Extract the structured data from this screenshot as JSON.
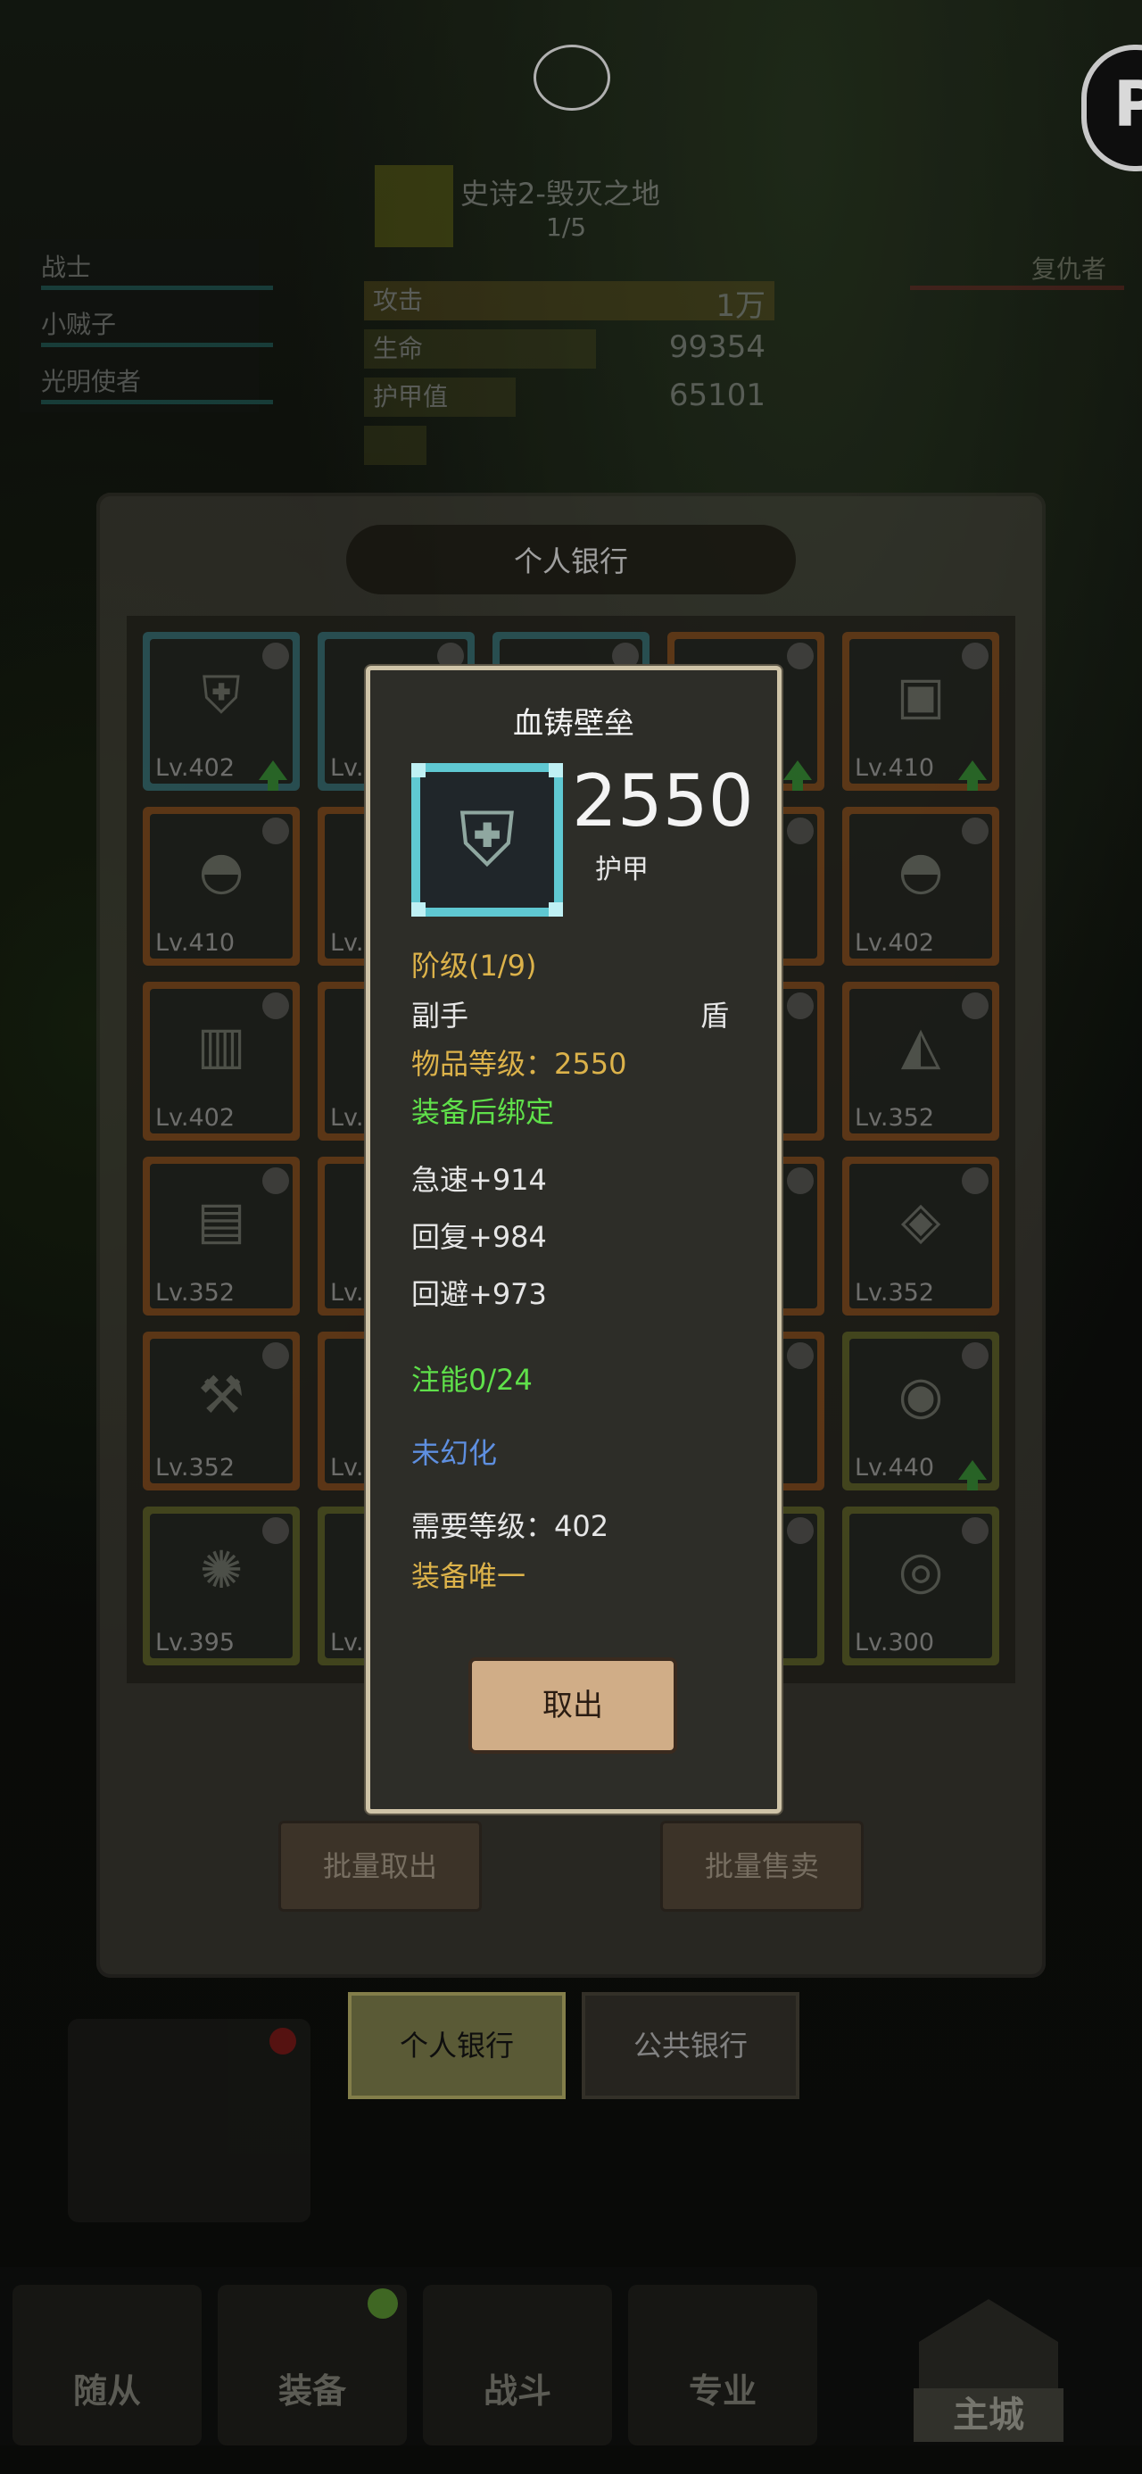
{
  "hud": {
    "stage_title": "史诗2-毁灭之地",
    "stage_progress": "1/5",
    "party": [
      "战士",
      "小贼子",
      "光明使者"
    ],
    "enemy": "复仇者",
    "stats": [
      {
        "label": "攻击",
        "value": "1万"
      },
      {
        "label": "生命",
        "value": "99354"
      },
      {
        "label": "护甲值",
        "value": "65101"
      }
    ]
  },
  "bank": {
    "title": "个人银行",
    "slots": [
      {
        "level": "Lv.402",
        "rarity": "teal",
        "upgrade": true,
        "icon": "shield-icon"
      },
      {
        "level": "Lv.",
        "rarity": "teal",
        "upgrade": false,
        "icon": "armor-icon"
      },
      {
        "level": "",
        "rarity": "teal",
        "upgrade": false,
        "icon": ""
      },
      {
        "level": "",
        "rarity": "orange",
        "upgrade": true,
        "icon": ""
      },
      {
        "level": "Lv.410",
        "rarity": "orange",
        "upgrade": true,
        "icon": "chest-icon"
      },
      {
        "level": "Lv.410",
        "rarity": "orange",
        "upgrade": false,
        "icon": "pauldron-icon"
      },
      {
        "level": "Lv.",
        "rarity": "orange",
        "upgrade": false,
        "icon": ""
      },
      {
        "level": "",
        "rarity": "orange",
        "upgrade": false,
        "icon": ""
      },
      {
        "level": "",
        "rarity": "orange",
        "upgrade": false,
        "icon": ""
      },
      {
        "level": "Lv.402",
        "rarity": "orange",
        "upgrade": false,
        "icon": "pauldron-icon"
      },
      {
        "level": "Lv.402",
        "rarity": "orange",
        "upgrade": false,
        "icon": "bracer-icon"
      },
      {
        "level": "Lv.",
        "rarity": "orange",
        "upgrade": false,
        "icon": ""
      },
      {
        "level": "",
        "rarity": "orange",
        "upgrade": false,
        "icon": ""
      },
      {
        "level": "",
        "rarity": "orange",
        "upgrade": false,
        "icon": ""
      },
      {
        "level": "Lv.352",
        "rarity": "orange",
        "upgrade": false,
        "icon": "boot-icon"
      },
      {
        "level": "Lv.352",
        "rarity": "orange",
        "upgrade": false,
        "icon": "chest-armor-icon"
      },
      {
        "level": "Lv.",
        "rarity": "orange",
        "upgrade": false,
        "icon": ""
      },
      {
        "level": "",
        "rarity": "orange",
        "upgrade": false,
        "icon": ""
      },
      {
        "level": "",
        "rarity": "orange",
        "upgrade": false,
        "icon": ""
      },
      {
        "level": "Lv.352",
        "rarity": "orange",
        "upgrade": false,
        "icon": "helmet-icon"
      },
      {
        "level": "Lv.352",
        "rarity": "orange",
        "upgrade": false,
        "icon": "mace-icon"
      },
      {
        "level": "Lv.",
        "rarity": "orange",
        "upgrade": false,
        "icon": ""
      },
      {
        "level": "",
        "rarity": "orange",
        "upgrade": false,
        "icon": ""
      },
      {
        "level": "",
        "rarity": "orange",
        "upgrade": false,
        "icon": ""
      },
      {
        "level": "Lv.440",
        "rarity": "green",
        "upgrade": true,
        "icon": "ring-icon"
      },
      {
        "level": "Lv.395",
        "rarity": "green",
        "upgrade": false,
        "icon": "amulet-icon"
      },
      {
        "level": "Lv.",
        "rarity": "green",
        "upgrade": false,
        "icon": ""
      },
      {
        "level": "",
        "rarity": "green",
        "upgrade": false,
        "icon": ""
      },
      {
        "level": "",
        "rarity": "green",
        "upgrade": false,
        "icon": ""
      },
      {
        "level": "Lv.300",
        "rarity": "green",
        "upgrade": false,
        "icon": "orb-icon"
      }
    ],
    "bulk_takeout": "批量取出",
    "bulk_sell": "批量售卖",
    "tab_personal": "个人银行",
    "tab_public": "公共银行"
  },
  "nav": {
    "followers": "随从",
    "equipment": "装备",
    "battle": "战斗",
    "profession": "专业",
    "main_city": "主城"
  },
  "tooltip": {
    "name": "血铸壁垒",
    "armor_value": "2550",
    "armor_label": "护甲",
    "tier": "阶级(1/9)",
    "slot": "副手",
    "type": "盾",
    "item_level": "物品等级：2550",
    "bind": "装备后绑定",
    "stats": [
      "急速+914",
      "回复+984",
      "回避+973"
    ],
    "infusion": "注能0/24",
    "transmog": "未幻化",
    "required_level": "需要等级：402",
    "unique": "装备唯一",
    "take_out": "取出"
  },
  "colors": {
    "gold": "#dcb24a",
    "green": "#5fe04a",
    "blue": "#5e8fe0",
    "teal_frame": "#5fc8d2",
    "dialog_bg": "#2d2d28"
  }
}
